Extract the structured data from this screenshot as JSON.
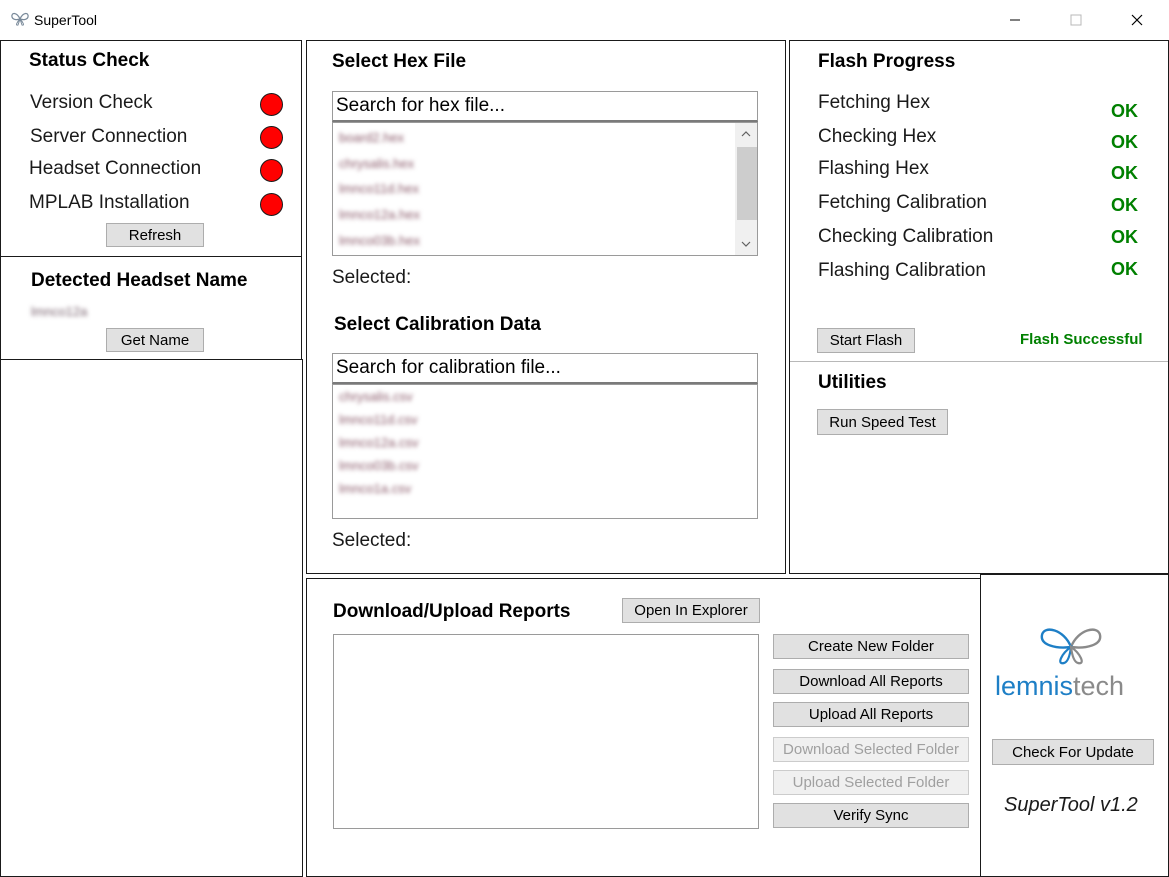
{
  "window": {
    "title": "SuperTool",
    "icon": "butterfly-icon",
    "controls": [
      "minimize-icon",
      "maximize-icon",
      "close-icon"
    ]
  },
  "status_check": {
    "title": "Status Check",
    "items": [
      {
        "label": "Version Check",
        "status_color": "#ff0000"
      },
      {
        "label": "Server Connection",
        "status_color": "#ff0000"
      },
      {
        "label": "Headset Connection",
        "status_color": "#ff0000"
      },
      {
        "label": "MPLAB Installation",
        "status_color": "#ff0000"
      }
    ],
    "refresh_label": "Refresh"
  },
  "headset": {
    "title": "Detected Headset Name",
    "name": "lmnco12a",
    "get_name_label": "Get Name"
  },
  "hex": {
    "title": "Select Hex File",
    "placeholder": "Search for hex file...",
    "files": [
      "board2.hex",
      "chrysalis.hex",
      "lmnco11d.hex",
      "lmnco12a.hex",
      "lmnco03b.hex"
    ],
    "selected_label": "Selected:"
  },
  "calibration": {
    "title": "Select Calibration Data",
    "placeholder": "Search for calibration file...",
    "files": [
      "chrysalis.csv",
      "lmnco11d.csv",
      "lmnco12a.csv",
      "lmnco03b.csv",
      "lmnco1a.csv"
    ],
    "selected_label": "Selected:"
  },
  "flash": {
    "title": "Flash Progress",
    "steps": [
      {
        "label": "Fetching Hex",
        "status": "OK"
      },
      {
        "label": "Checking Hex",
        "status": "OK"
      },
      {
        "label": "Flashing Hex",
        "status": "OK"
      },
      {
        "label": "Fetching Calibration",
        "status": "OK"
      },
      {
        "label": "Checking Calibration",
        "status": "OK"
      },
      {
        "label": "Flashing Calibration",
        "status": "OK"
      }
    ],
    "start_label": "Start Flash",
    "result": "Flash Successful",
    "ok_color": "#008000"
  },
  "utilities": {
    "title": "Utilities",
    "speed_test_label": "Run Speed Test"
  },
  "reports": {
    "title": "Download/Upload Reports",
    "open_explorer_label": "Open In Explorer",
    "buttons": {
      "create_folder": "Create New Folder",
      "download_all": "Download All Reports",
      "upload_all": "Upload All Reports",
      "download_selected": "Download Selected Folder",
      "upload_selected": "Upload Selected Folder",
      "verify_sync": "Verify Sync"
    }
  },
  "brand": {
    "logo_text_a": "lemnis",
    "logo_text_b": "tech",
    "logo_colors": [
      "#1e7fc6",
      "#8a8a8a"
    ],
    "update_label": "Check For Update",
    "version": "SuperTool v1.2"
  }
}
